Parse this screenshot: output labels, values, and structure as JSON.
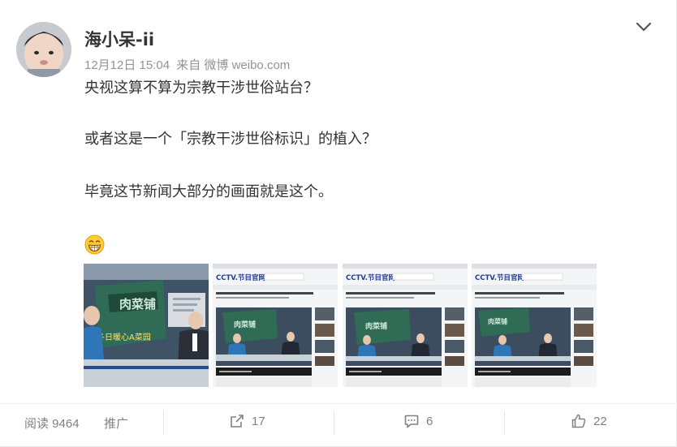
{
  "post": {
    "username": "海小呆-ii",
    "date": "12月12日 15:04",
    "source": "来自 微博 weibo.com",
    "paragraphs": [
      "央视这算不算为宗教干涉世俗站台？",
      "或者这是一个「宗教干涉世俗标识」的植入？",
      "毕竟这节新闻大部分的画面就是这个。"
    ],
    "emoji": "grinning-face-emoji",
    "images": [
      {
        "name": "news-image-1",
        "overlay_text": "冬日暖心A菜园"
      },
      {
        "name": "news-image-2",
        "logo": "CCTV.节目官网"
      },
      {
        "name": "news-image-3",
        "logo": "CCTV.节目官网"
      },
      {
        "name": "news-image-4",
        "logo": "CCTV.节目官网"
      }
    ]
  },
  "footer": {
    "read_label": "阅读 9464",
    "promote_label": "推广",
    "share_count": "17",
    "comment_count": "6",
    "like_count": "22"
  },
  "icons": {
    "menu": "chevron-down-icon",
    "share": "share-icon",
    "comment": "comment-icon",
    "like": "thumbs-up-icon"
  },
  "colors": {
    "text": "#333333",
    "meta": "#939393",
    "action": "#808080",
    "news_blue": "#2a5aa8",
    "news_green": "#2f6b55"
  }
}
